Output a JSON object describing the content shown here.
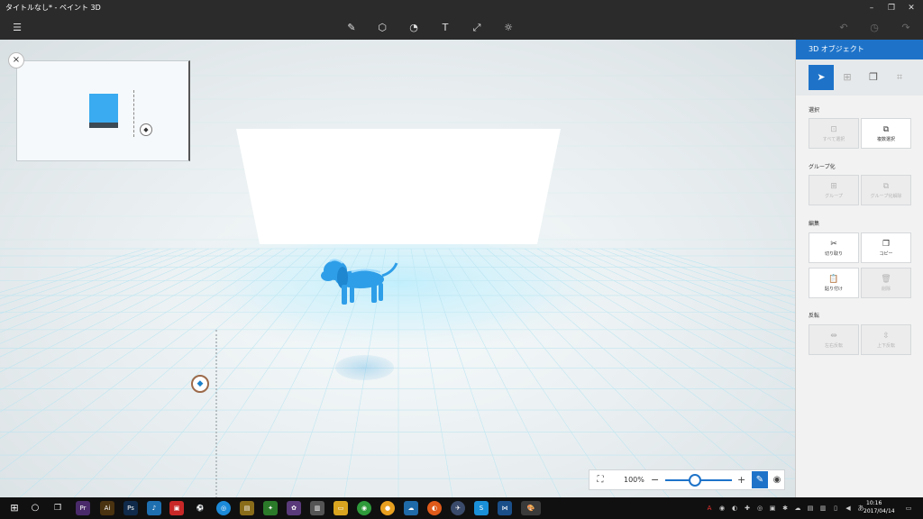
{
  "window": {
    "title": "タイトルなし* - ペイント 3D",
    "minimize_icon": "minimize-icon",
    "maximize_icon": "restore-icon",
    "close_icon": "close-icon"
  },
  "toolbar": {
    "menu_icon": "hamburger-menu-icon",
    "tools": [
      "brush-icon",
      "3d-shapes-icon",
      "stickers-icon",
      "text-icon",
      "canvas-icon",
      "effects-icon"
    ],
    "undo_icon": "undo-icon",
    "history_icon": "history-icon",
    "redo_icon": "redo-icon"
  },
  "preview": {
    "close_label": "×"
  },
  "zoom": {
    "value": "100%",
    "level_fraction": 0.45,
    "minus_label": "−",
    "plus_label": "+"
  },
  "panel": {
    "title": "3D オブジェクト",
    "tabs": [
      "select-icon",
      "add-3d-icon",
      "paste-icon",
      "crop-icon"
    ],
    "sections": {
      "select": {
        "title": "選択",
        "select_all": "すべて選択",
        "multi_select": "複数選択"
      },
      "group": {
        "title": "グループ化",
        "group": "グループ",
        "ungroup": "グループ化解除"
      },
      "edit": {
        "title": "編集",
        "cut": "切り取り",
        "copy": "コピー",
        "paste": "貼り付け",
        "delete": "削除"
      },
      "flip": {
        "title": "反転",
        "flip_horizontal": "左右反転",
        "flip_vertical": "上下反転"
      }
    }
  },
  "taskbar": {
    "clock_time": "10:16",
    "clock_date": "2017/04/14"
  },
  "colors": {
    "accent": "#1e73c9",
    "chrome": "#2b2b2b",
    "object": "#3aabf0"
  }
}
